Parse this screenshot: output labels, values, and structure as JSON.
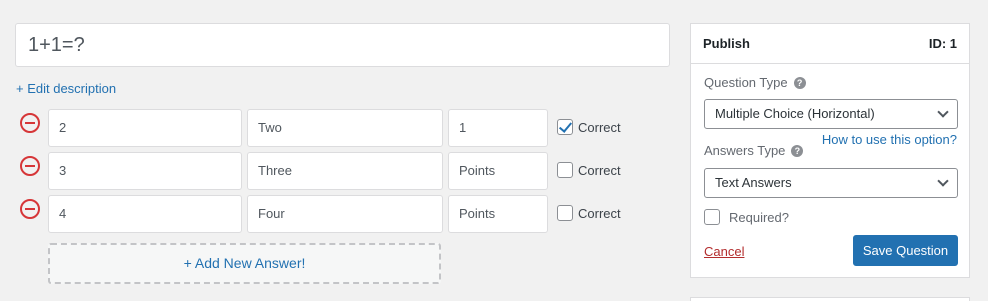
{
  "question": {
    "title": "1+1=?",
    "edit_description_label": "+ Edit description"
  },
  "answers": [
    {
      "value": "2",
      "text": "Two",
      "points": "1",
      "correct_label": "Correct",
      "correct": true
    },
    {
      "value": "3",
      "text": "Three",
      "points": "Points",
      "correct_label": "Correct",
      "correct": false
    },
    {
      "value": "4",
      "text": "Four",
      "points": "Points",
      "correct_label": "Correct",
      "correct": false
    }
  ],
  "add_answer_label": "+ Add New Answer!",
  "publish": {
    "title": "Publish",
    "id_label": "ID: 1",
    "question_type_label": "Question Type",
    "question_type_value": "Multiple Choice (Horizontal)",
    "how_to_use_link": "How to use this option?",
    "answers_type_label": "Answers Type",
    "answers_type_value": "Text Answers",
    "required_label": "Required?",
    "cancel_label": "Cancel",
    "save_label": "Save Question"
  },
  "icons": {
    "remove": "minus-circle-icon",
    "help": "question-circle-icon",
    "dropdown": "chevron-down-icon"
  },
  "colors": {
    "primary": "#2271b1",
    "danger": "#d63638"
  }
}
